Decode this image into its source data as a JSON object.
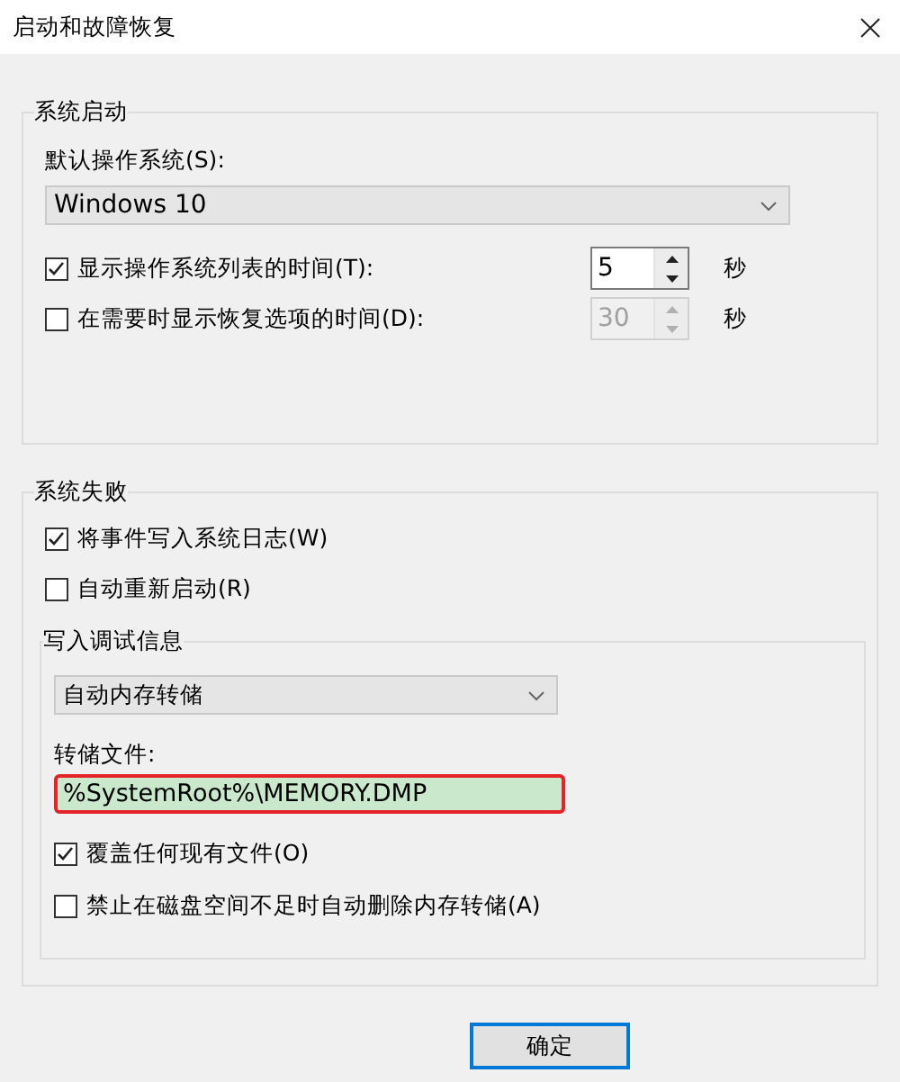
{
  "window": {
    "title": "启动和故障恢复"
  },
  "system_startup": {
    "legend": "系统启动",
    "default_os_label": "默认操作系统(S):",
    "default_os": {
      "value": "Windows 10"
    },
    "timers": [
      {
        "label": "显示操作系统列表的时间(T):",
        "checked": true,
        "value": "5",
        "disabled": false,
        "unit": "秒"
      },
      {
        "label": "在需要时显示恢复选项的时间(D):",
        "checked": false,
        "value": "30",
        "disabled": true,
        "unit": "秒"
      }
    ]
  },
  "system_failure": {
    "legend": "系统失败",
    "options": [
      {
        "label": "将事件写入系统日志(W)",
        "checked": true
      },
      {
        "label": "自动重新启动(R)",
        "checked": false
      }
    ],
    "debug_info": {
      "legend": "写入调试信息",
      "dump_type": {
        "value": "自动内存转储"
      },
      "dump_file_label": "转储文件:",
      "dump_file": {
        "value": "%SystemRoot%\\MEMORY.DMP",
        "highlighted": true
      },
      "options": [
        {
          "label": "覆盖任何现有文件(O)",
          "checked": true
        },
        {
          "label": "禁止在磁盘空间不足时自动删除内存转储(A)",
          "checked": false
        }
      ]
    }
  },
  "buttons": [
    {
      "label": "确定",
      "default": true
    }
  ]
}
